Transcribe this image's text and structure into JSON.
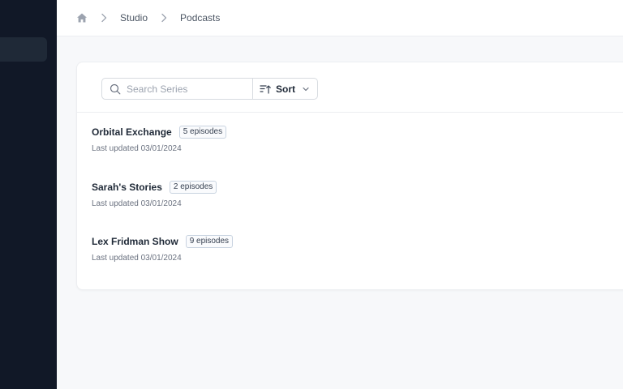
{
  "breadcrumb": {
    "home_icon": "home-icon",
    "items": [
      "Studio",
      "Podcasts"
    ]
  },
  "search": {
    "placeholder": "Search Series",
    "value": ""
  },
  "sort": {
    "label": "Sort"
  },
  "series": [
    {
      "title": "Orbital Exchange",
      "episodes": "5 episodes",
      "updated": "Last updated 03/01/2024"
    },
    {
      "title": "Sarah's Stories",
      "episodes": "2 episodes",
      "updated": "Last updated 03/01/2024"
    },
    {
      "title": "Lex Fridman Show",
      "episodes": "9 episodes",
      "updated": "Last updated 03/01/2024"
    }
  ],
  "colors": {
    "sidebar": "#111827",
    "sidebar_active": "#1f2937",
    "background": "#f7f8fa",
    "card": "#ffffff"
  }
}
